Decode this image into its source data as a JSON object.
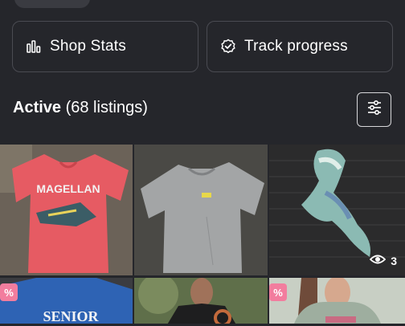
{
  "actions": {
    "shop_stats_label": "Shop Stats",
    "track_progress_label": "Track progress"
  },
  "listings": {
    "active_label": "Active",
    "count_label": "(68 listings)"
  },
  "grid": {
    "items": [
      {
        "name": "Magellan outdoors red shirt",
        "print": "MAGELLAN"
      },
      {
        "name": "Grey t-shirt"
      },
      {
        "name": "Tie-dye embroidered item",
        "views": "3"
      },
      {
        "name": "Blue senior shirt",
        "badge": "%",
        "print": "SENIOR"
      },
      {
        "name": "Black graphic tee"
      },
      {
        "name": "Sage hoodie",
        "badge": "%"
      }
    ]
  },
  "colors": {
    "background": "#25262b",
    "border": "#4a4b52",
    "badge": "#f27d9e"
  }
}
